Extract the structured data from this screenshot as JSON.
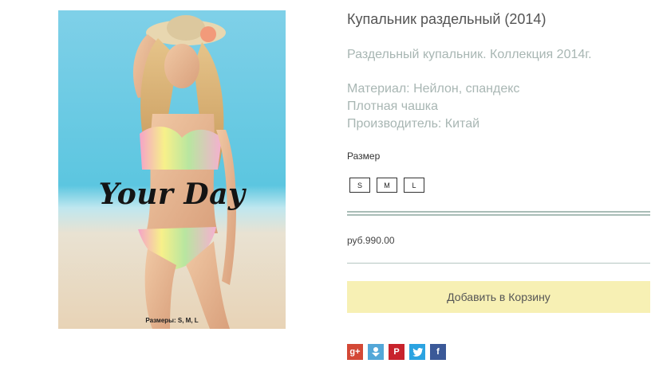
{
  "product": {
    "image": {
      "brand_text": "Your Day",
      "sizes_caption": "Размеры: S, M, L"
    },
    "title": "Купальник раздельный (2014)",
    "description": "Раздельный купальник. Коллекция 2014г.",
    "specs": [
      "Материал: Нейлон, спандекс",
      "Плотная чашка",
      "Производитель: Китай"
    ],
    "size_label": "Размер",
    "sizes": [
      "S",
      "M",
      "L"
    ],
    "price": "руб.990.00",
    "add_to_cart_label": "Добавить в Корзину"
  },
  "share": [
    {
      "name": "google-plus-icon",
      "glyph": "g+",
      "color": "#d34836"
    },
    {
      "name": "odnoklassniki-icon",
      "glyph": "",
      "color": "#53a7d8"
    },
    {
      "name": "pinterest-icon",
      "glyph": "P",
      "color": "#c8232c"
    },
    {
      "name": "twitter-icon",
      "glyph": "",
      "color": "#2ba3e1"
    },
    {
      "name": "facebook-icon",
      "glyph": "f",
      "color": "#3b5998"
    }
  ],
  "colors": {
    "muted_text": "#a8b6b3",
    "rule": "#a9bdb7",
    "cart_button_bg": "#f7f0b4"
  }
}
